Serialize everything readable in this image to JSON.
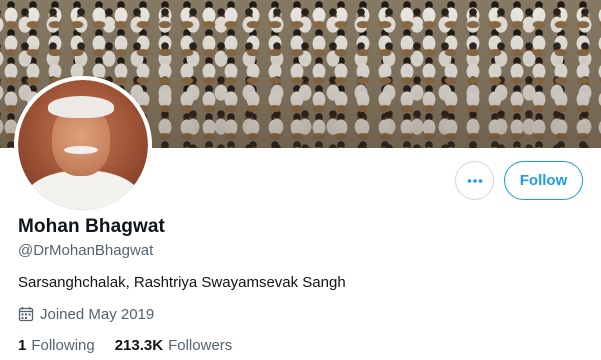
{
  "profile": {
    "display_name": "Mohan Bhagwat",
    "handle": "@DrMohanBhagwat",
    "bio": "Sarsanghchalak, Rashtriya Swayamsevak Sangh",
    "joined": "Joined May 2019",
    "following_count": "1",
    "following_label": "Following",
    "followers_count": "213.3K",
    "followers_label": "Followers"
  },
  "actions": {
    "follow_label": "Follow",
    "more_icon": "more-horizontal-icon"
  },
  "icons": {
    "calendar": "calendar-icon"
  },
  "colors": {
    "accent": "#1d9bf0",
    "text_primary": "#0f1419",
    "text_secondary": "#536471",
    "border": "#cfd9de"
  }
}
